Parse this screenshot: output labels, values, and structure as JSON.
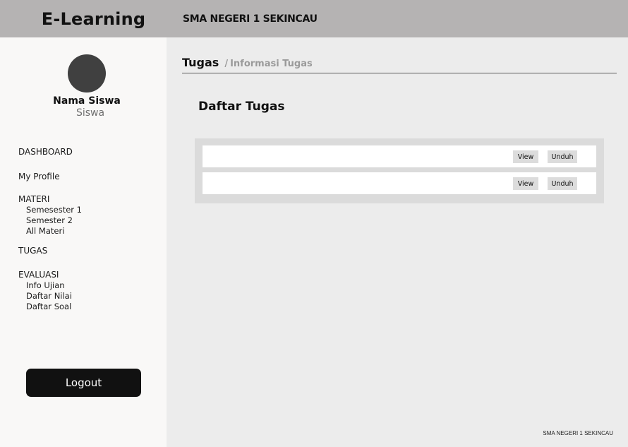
{
  "header": {
    "brand": "E-Learning",
    "school": "SMA NEGERI 1 SEKINCAU"
  },
  "sidebar": {
    "user_name": "Nama Siswa",
    "user_role": "Siswa",
    "nav": {
      "dashboard": "DASHBOARD",
      "my_profile": "My Profile",
      "materi": "MATERI",
      "materi_items": [
        "Semesester 1",
        "Semester 2",
        "All Materi"
      ],
      "tugas": "TUGAS",
      "evaluasi": "EVALUASI",
      "evaluasi_items": [
        "Info Ujian",
        "Daftar Nilai",
        "Daftar Soal"
      ]
    },
    "logout_label": "Logout"
  },
  "main": {
    "breadcrumb": {
      "current": "Tugas",
      "separator": "/",
      "sub": "Informasi Tugas"
    },
    "section_title": "Daftar Tugas",
    "tasks": [
      {
        "view_label": "View",
        "download_label": "Unduh"
      },
      {
        "view_label": "View",
        "download_label": "Unduh"
      }
    ],
    "footer": "SMA NEGERI 1 SEKINCAU"
  },
  "colors": {
    "topbar": "#b5b3b3",
    "sidebar": "#f9f8f7",
    "main_bg": "#ececec",
    "panel": "#dbdbdb",
    "logout_bg": "#111111"
  }
}
